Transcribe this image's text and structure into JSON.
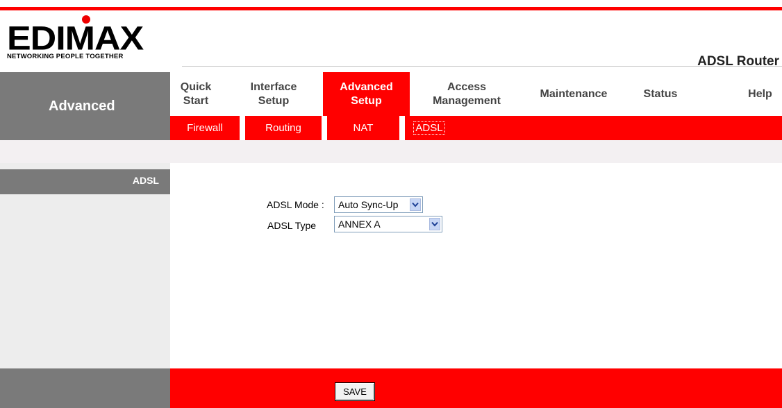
{
  "brand": {
    "logo_text": "EDIMAX",
    "tagline": "NETWORKING PEOPLE TOGETHER",
    "product": "ADSL Router",
    "accent_color": "#ff0000"
  },
  "sidebar": {
    "title": "Advanced",
    "section": "ADSL"
  },
  "nav": {
    "items": [
      {
        "label": "Quick Start"
      },
      {
        "label": "Interface Setup"
      },
      {
        "label": "Advanced Setup"
      },
      {
        "label": "Access Management"
      },
      {
        "label": "Maintenance"
      },
      {
        "label": "Status"
      },
      {
        "label": "Help"
      }
    ],
    "active": "Advanced Setup"
  },
  "subnav": {
    "items": [
      {
        "label": "Firewall"
      },
      {
        "label": "Routing"
      },
      {
        "label": "NAT"
      },
      {
        "label": "ADSL"
      }
    ],
    "active": "ADSL"
  },
  "form": {
    "mode_label": "ADSL Mode :",
    "mode_value": "Auto Sync-Up",
    "type_label": "ADSL Type",
    "type_value": "ANNEX A"
  },
  "footer": {
    "save_label": "SAVE"
  }
}
